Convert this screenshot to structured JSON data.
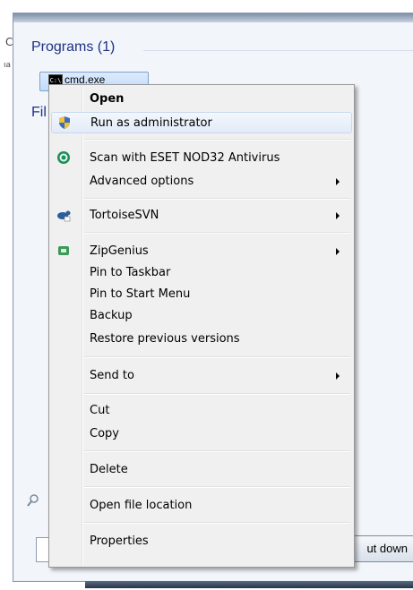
{
  "start_menu": {
    "programs_title": "Programs (1)",
    "program_result": "cmd.exe",
    "cmd_icon_text": "C:\\",
    "files_title": "Fil",
    "shutdown_label": "ut down",
    "edge_glyph_top": "C",
    "edge_glyph_mid": "ıa"
  },
  "context_menu": {
    "items": [
      {
        "label": "Open",
        "bold": true,
        "icon": "none"
      },
      {
        "label": "Run as administrator",
        "icon": "uac-shield-icon"
      },
      {
        "label": "Scan with ESET NOD32 Antivirus",
        "icon": "eset-icon"
      },
      {
        "label": "Advanced options",
        "submenu": true
      },
      {
        "label": "TortoiseSVN",
        "icon": "tortoisesvn-icon",
        "submenu": true
      },
      {
        "label": "ZipGenius",
        "icon": "zipgenius-icon",
        "submenu": true
      },
      {
        "label": "Pin to Taskbar"
      },
      {
        "label": "Pin to Start Menu"
      },
      {
        "label": "Backup"
      },
      {
        "label": "Restore previous versions"
      },
      {
        "label": "Send to",
        "submenu": true
      },
      {
        "label": "Cut"
      },
      {
        "label": "Copy"
      },
      {
        "label": "Delete"
      },
      {
        "label": "Open file location"
      },
      {
        "label": "Properties"
      }
    ]
  },
  "colors": {
    "section_title": "#1e3287",
    "menu_bg": "#f0f0f0",
    "hover_bg": "#e1ebf7"
  }
}
